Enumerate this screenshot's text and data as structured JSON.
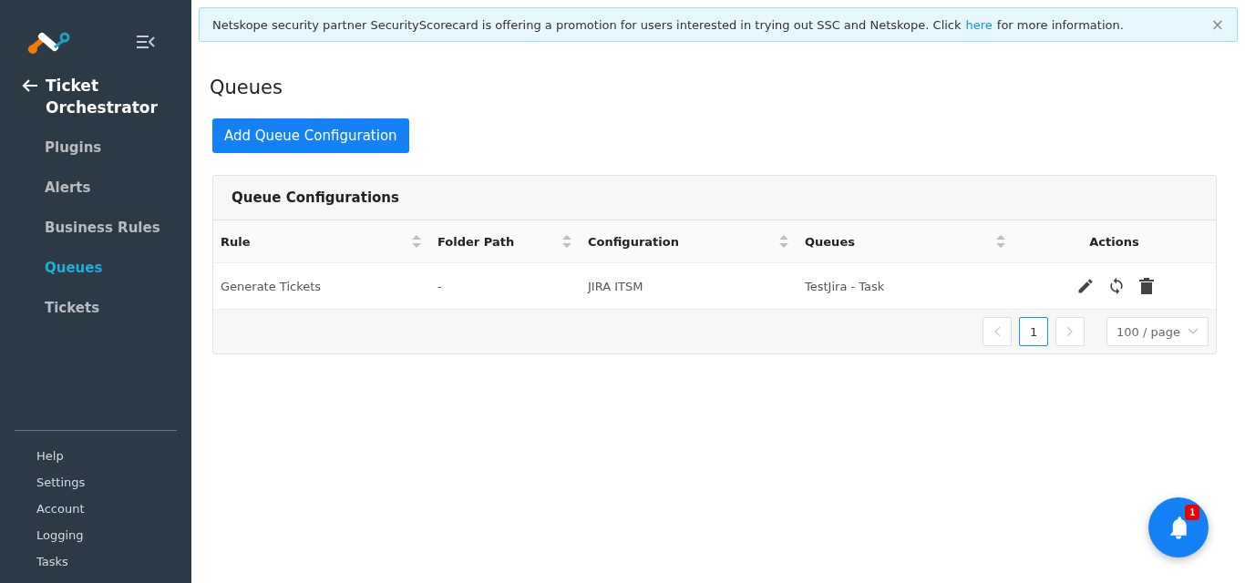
{
  "sidebar": {
    "title": "Ticket Orchestrator",
    "items": [
      {
        "label": "Plugins",
        "selected": false
      },
      {
        "label": "Alerts",
        "selected": false
      },
      {
        "label": "Business Rules",
        "selected": false
      },
      {
        "label": "Queues",
        "selected": true
      },
      {
        "label": "Tickets",
        "selected": false
      }
    ],
    "footer_items": [
      "Help",
      "Settings",
      "Account",
      "Logging",
      "Tasks"
    ]
  },
  "banner": {
    "text_before": "Netskope security partner SecurityScorecard is offering a promotion for users interested in trying out SSC and Netskope. Click",
    "link": "here",
    "text_after": "for more information.",
    "close": "×"
  },
  "page": {
    "title": "Queues",
    "add_button": "Add Queue Configuration"
  },
  "table": {
    "title": "Queue Configurations",
    "columns": [
      {
        "label": "Rule",
        "sortable": true
      },
      {
        "label": "Folder Path",
        "sortable": true
      },
      {
        "label": "Configuration",
        "sortable": true
      },
      {
        "label": "Queues",
        "sortable": true
      },
      {
        "label": "Actions",
        "sortable": false
      }
    ],
    "rows": [
      {
        "cells": [
          "Generate Tickets",
          "-",
          "JIRA ITSM",
          "TestJira - Task"
        ]
      }
    ],
    "pagination": {
      "prev_disabled": true,
      "next_disabled": true,
      "pages": [
        {
          "label": "1",
          "selected": true
        }
      ],
      "page_size": "100 / page"
    }
  },
  "notifications": {
    "count": "1"
  }
}
